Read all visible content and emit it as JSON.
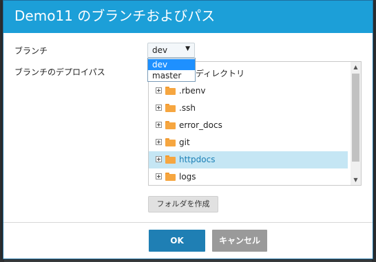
{
  "dialog": {
    "title": "Demo11 のブランチおよびパス"
  },
  "form": {
    "branch_label": "ブランチ",
    "deploy_path_label": "ブランチのデプロイパス"
  },
  "branch_select": {
    "selected": "dev",
    "options": [
      "dev",
      "master"
    ],
    "highlighted": "dev"
  },
  "tree": {
    "root_label": "ディレクトリ",
    "items": [
      {
        "name": ".rbenv",
        "selected": false
      },
      {
        "name": ".ssh",
        "selected": false
      },
      {
        "name": "error_docs",
        "selected": false
      },
      {
        "name": "git",
        "selected": false
      },
      {
        "name": "httpdocs",
        "selected": true
      },
      {
        "name": "logs",
        "selected": false
      }
    ]
  },
  "buttons": {
    "create_folder": "フォルダを作成",
    "ok": "OK",
    "cancel": "キャンセル"
  },
  "icons": {
    "expander": "plus-box-icon",
    "folder": "folder-icon",
    "dropdown_arrow": "caret-down-icon",
    "scroll_up": "scroll-up-icon",
    "scroll_down": "scroll-down-icon"
  },
  "colors": {
    "titlebar": "#1c9fd8",
    "ok_button": "#1f7fb4",
    "cancel_button": "#9a9a9a",
    "selected_row": "#c5e6f4",
    "folder": "#f6a640"
  }
}
